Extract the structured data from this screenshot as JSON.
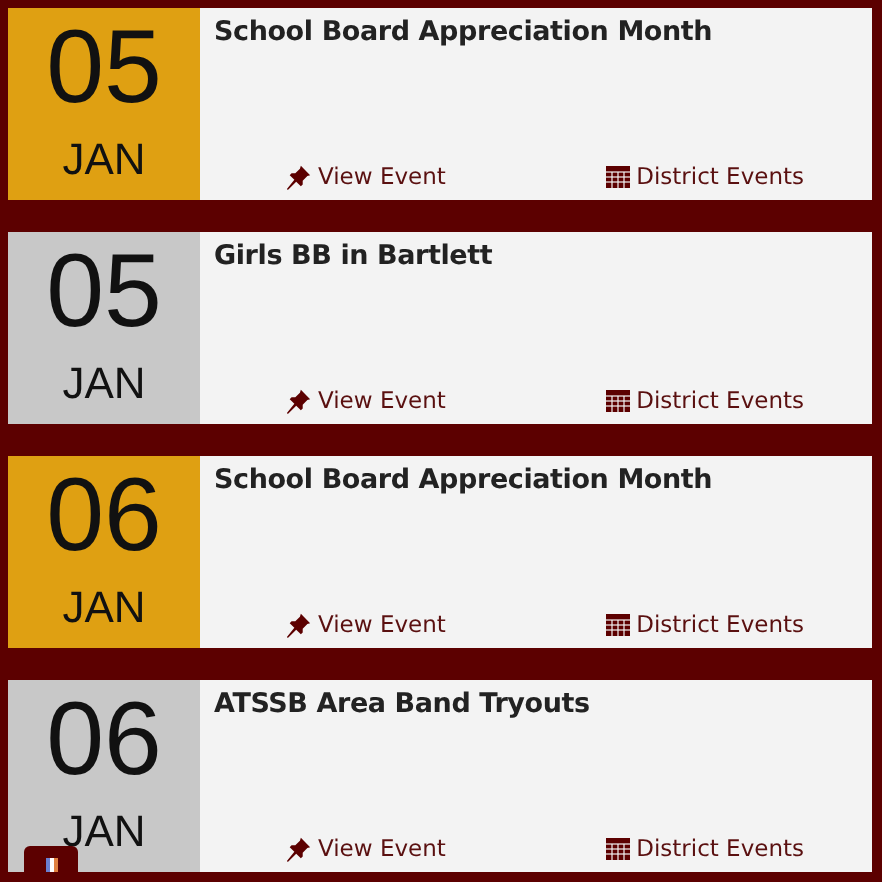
{
  "events": [
    {
      "day": "05",
      "month": "JAN",
      "title": "School Board Appreciation Month",
      "highlighted": true,
      "view_link": "View Event",
      "calendar_link": "District Events"
    },
    {
      "day": "05",
      "month": "JAN",
      "title": "Girls BB in Bartlett",
      "highlighted": false,
      "view_link": "View Event",
      "calendar_link": "District Events"
    },
    {
      "day": "06",
      "month": "JAN",
      "title": "School Board Appreciation Month",
      "highlighted": true,
      "view_link": "View Event",
      "calendar_link": "District Events"
    },
    {
      "day": "06",
      "month": "JAN",
      "title": "ATSSB Area Band Tryouts",
      "highlighted": false,
      "view_link": "View Event",
      "calendar_link": "District Events"
    }
  ]
}
